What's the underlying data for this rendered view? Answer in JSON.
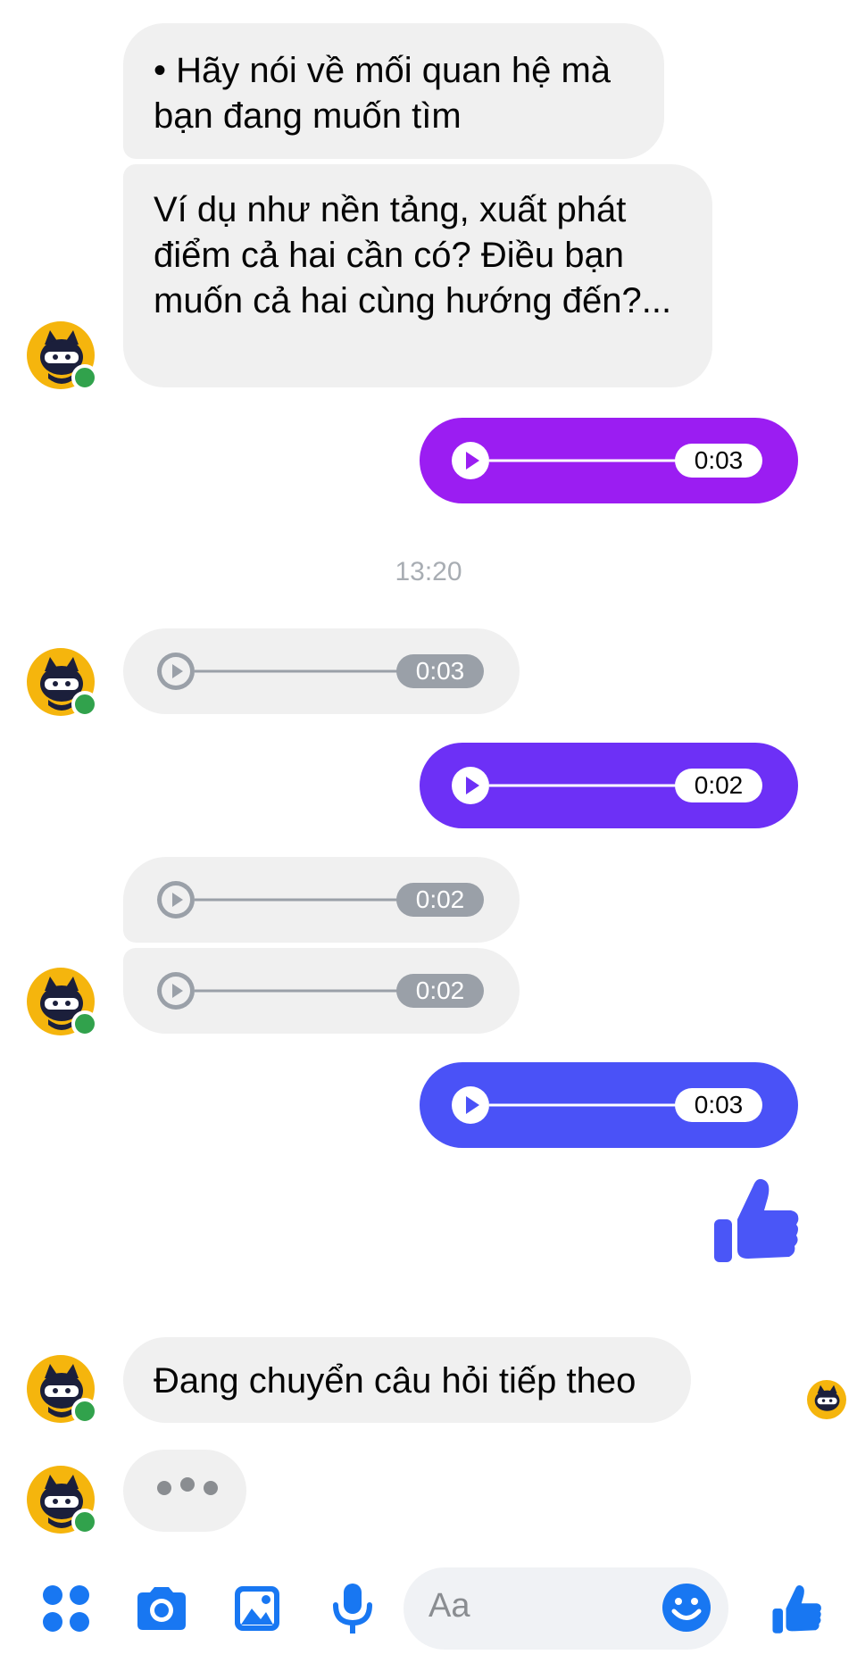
{
  "thread": {
    "msg1": "• Hãy nói về mối quan hệ mà bạn đang muốn tìm",
    "msg2": "Ví dụ như nền tảng, xuất phát điểm cả hai cần có? Điều bạn muốn cả hai cùng hướng đến?...",
    "audio_out_1": "0:03",
    "timestamp": "13:20",
    "audio_in_1": "0:03",
    "audio_out_2": "0:02",
    "audio_in_2": "0:02",
    "audio_in_3": "0:02",
    "audio_out_3": "0:03",
    "msg3": "Đang chuyển câu hỏi tiếp theo"
  },
  "composer": {
    "placeholder": "Aa"
  },
  "colors": {
    "accent": "#1877f2",
    "incoming_bubble": "#f0f0f0",
    "out_gradient": [
      "#9b1df2",
      "#7b2bf5",
      "#5b3ef7",
      "#4a52f7"
    ],
    "avatar_bg": "#f5b50d",
    "online": "#31a24c"
  },
  "icons": [
    "menu-dots-icon",
    "camera-icon",
    "image-icon",
    "microphone-icon",
    "emoji-icon",
    "thumbs-up-icon",
    "play-icon",
    "typing-dots-icon"
  ]
}
